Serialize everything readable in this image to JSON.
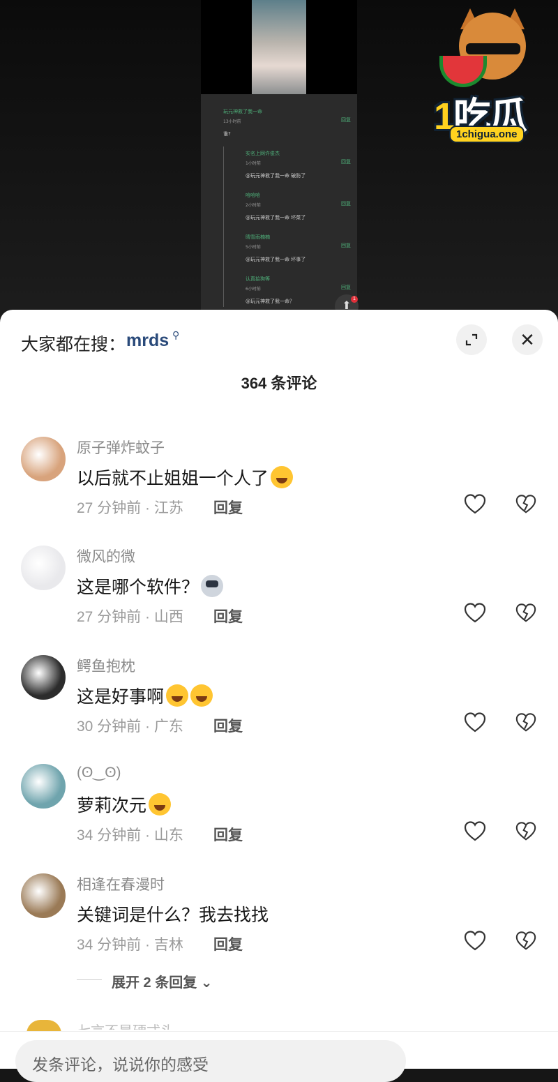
{
  "watermark": {
    "brand_digit": "1",
    "brand_name": "吃瓜",
    "url": "1chigua.one"
  },
  "background_thread": {
    "parent": {
      "name": "玩元神救了我一命",
      "time": "13小时前",
      "text": "谁?",
      "reply": "回复"
    },
    "replies": [
      {
        "name": "实名上网许俊杰",
        "time": "1小时前",
        "text": "@玩元神救了我一命 破防了",
        "reply": "回复"
      },
      {
        "name": "哈哈哈",
        "time": "2小时前",
        "text": "@玩元神救了我一命 坏菜了",
        "reply": "回复"
      },
      {
        "name": "晴雪雨楠楠",
        "time": "5小时前",
        "text": "@玩元神救了我一命 坏事了",
        "reply": "回复"
      },
      {
        "name": "认真拾狗等",
        "time": "6小时前",
        "text": "@玩元神救了我一命？",
        "reply": "回复"
      }
    ],
    "fab_badge": "1"
  },
  "sheet": {
    "search_prefix": "大家都在搜：",
    "search_term": "mrds",
    "comment_count": "364 条评论",
    "comments": [
      {
        "user": "原子弹炸蚊子",
        "text": "以后就不止姐姐一个人了",
        "emoji": "crying-laughing-emoji",
        "time_location": "27 分钟前 · 江苏",
        "reply_label": "回复",
        "avatar_color": "#d8a37c"
      },
      {
        "user": "微风的微",
        "text": "这是哪个软件？",
        "emoji": "cat-emoji",
        "time_location": "27 分钟前 · 山西",
        "reply_label": "回复",
        "avatar_color": "#e9e9ec"
      },
      {
        "user": "鳄鱼抱枕",
        "text": "这是好事啊",
        "emoji": "crying-laughing-emoji",
        "time_location": "30 分钟前 · 广东",
        "reply_label": "回复",
        "avatar_color": "#2c2c2c"
      },
      {
        "user": "(ʘ‿ʘ)",
        "text": "萝莉次元",
        "emoji": "crying-laughing-emoji",
        "time_location": "34 分钟前 · 山东",
        "reply_label": "回复",
        "avatar_color": "#6fa4ad"
      },
      {
        "user": "相逢在春漫时",
        "text": "关键词是什么？我去找找",
        "emoji": "",
        "time_location": "34 分钟前 · 吉林",
        "reply_label": "回复",
        "avatar_color": "#9a7a56"
      }
    ],
    "expand_replies": "展开 2 条回复",
    "cut_comment_user": "七言不是硬式头",
    "input_placeholder": "发条评论，说说你的感受"
  },
  "colors": {
    "accent_link": "#2a4a7a",
    "thread_name_green": "#4fb07a"
  }
}
